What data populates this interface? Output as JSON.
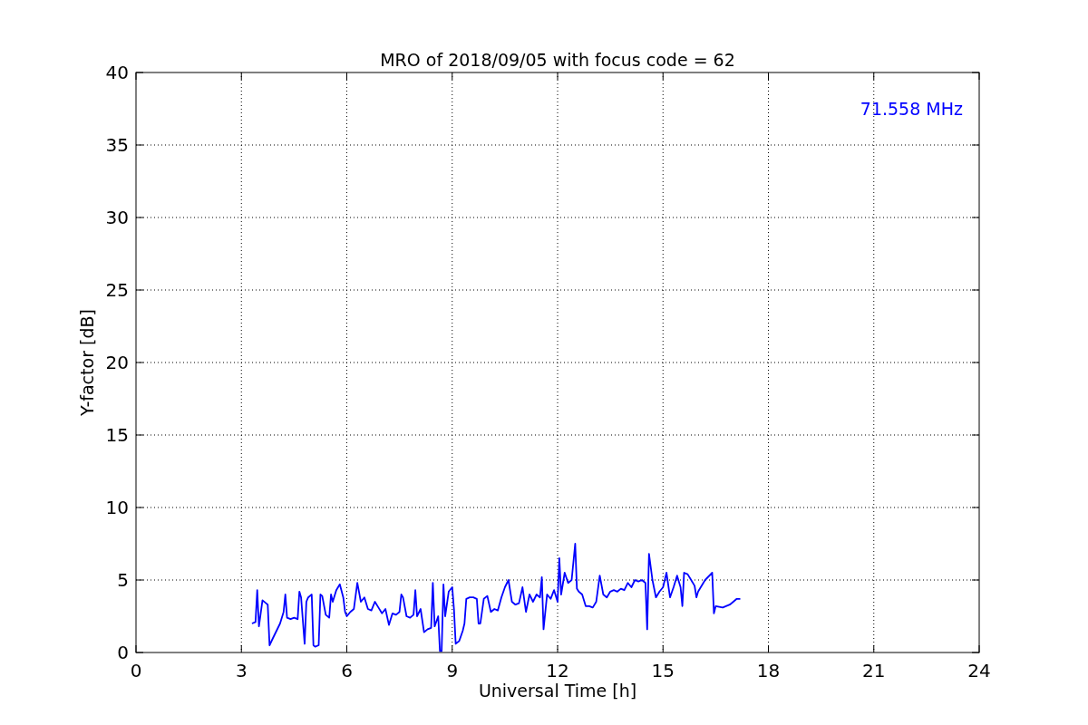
{
  "figure": {
    "chart_data": {
      "type": "line",
      "title": "MRO of 2018/09/05 with focus code = 62",
      "xlabel": "Universal Time [h]",
      "ylabel": "Y-factor [dB]",
      "x": [
        3.3,
        3.4,
        3.45,
        3.5,
        3.6,
        3.7,
        3.75,
        3.8,
        3.9,
        4.0,
        4.1,
        4.2,
        4.25,
        4.3,
        4.4,
        4.5,
        4.6,
        4.65,
        4.7,
        4.8,
        4.85,
        4.9,
        5.0,
        5.05,
        5.1,
        5.2,
        5.25,
        5.3,
        5.4,
        5.5,
        5.55,
        5.6,
        5.7,
        5.8,
        5.9,
        5.95,
        6.0,
        6.1,
        6.2,
        6.3,
        6.4,
        6.5,
        6.6,
        6.7,
        6.8,
        6.9,
        7.0,
        7.1,
        7.2,
        7.3,
        7.4,
        7.5,
        7.55,
        7.6,
        7.7,
        7.8,
        7.9,
        7.95,
        8.0,
        8.1,
        8.2,
        8.3,
        8.4,
        8.45,
        8.5,
        8.6,
        8.65,
        8.7,
        8.75,
        8.8,
        8.9,
        9.0,
        9.05,
        9.1,
        9.2,
        9.3,
        9.35,
        9.4,
        9.5,
        9.6,
        9.7,
        9.75,
        9.8,
        9.9,
        10.0,
        10.1,
        10.2,
        10.3,
        10.4,
        10.5,
        10.6,
        10.7,
        10.8,
        10.9,
        11.0,
        11.1,
        11.2,
        11.3,
        11.4,
        11.5,
        11.55,
        11.6,
        11.7,
        11.8,
        11.9,
        12.0,
        12.05,
        12.1,
        12.2,
        12.3,
        12.4,
        12.5,
        12.55,
        12.6,
        12.7,
        12.8,
        12.9,
        13.0,
        13.1,
        13.2,
        13.3,
        13.4,
        13.5,
        13.6,
        13.7,
        13.8,
        13.9,
        14.0,
        14.1,
        14.2,
        14.3,
        14.4,
        14.5,
        14.55,
        14.6,
        14.7,
        14.8,
        14.9,
        15.0,
        15.1,
        15.2,
        15.3,
        15.4,
        15.5,
        15.55,
        15.6,
        15.7,
        15.8,
        15.9,
        15.95,
        16.0,
        16.2,
        16.4,
        16.45,
        16.5,
        16.7,
        16.9,
        17.0,
        17.1,
        17.2
      ],
      "series": [
        {
          "color": "#0000ff",
          "values": [
            2.0,
            2.1,
            4.3,
            1.8,
            3.6,
            3.4,
            3.3,
            0.5,
            1.0,
            1.5,
            2.0,
            2.8,
            4.0,
            2.4,
            2.3,
            2.4,
            2.3,
            4.2,
            3.8,
            0.6,
            3.5,
            3.8,
            4.0,
            0.5,
            0.4,
            0.5,
            4.0,
            3.9,
            2.6,
            2.4,
            4.0,
            3.5,
            4.3,
            4.7,
            3.8,
            2.8,
            2.5,
            2.8,
            3.0,
            4.8,
            3.5,
            3.8,
            3.0,
            2.9,
            3.5,
            3.1,
            2.7,
            3.0,
            1.9,
            2.7,
            2.6,
            2.8,
            4.0,
            3.8,
            2.5,
            2.4,
            2.6,
            4.3,
            2.5,
            3.0,
            1.4,
            1.6,
            1.7,
            4.8,
            1.8,
            2.5,
            0.1,
            0.1,
            4.7,
            2.5,
            4.2,
            4.5,
            3.0,
            0.6,
            0.8,
            1.5,
            2.0,
            3.7,
            3.8,
            3.8,
            3.7,
            2.0,
            2.0,
            3.7,
            3.9,
            2.8,
            3.0,
            2.9,
            3.8,
            4.5,
            5.0,
            3.5,
            3.3,
            3.4,
            4.5,
            2.8,
            4.0,
            3.5,
            4.0,
            3.8,
            5.2,
            1.6,
            4.0,
            3.7,
            4.3,
            3.5,
            6.5,
            4.0,
            5.5,
            4.8,
            5.0,
            7.5,
            4.4,
            4.2,
            4.0,
            3.2,
            3.2,
            3.1,
            3.5,
            5.3,
            4.0,
            3.8,
            4.2,
            4.3,
            4.2,
            4.4,
            4.3,
            4.8,
            4.5,
            5.0,
            4.9,
            5.0,
            4.8,
            1.6,
            6.8,
            5.0,
            3.8,
            4.2,
            4.5,
            5.5,
            3.8,
            4.5,
            5.3,
            4.5,
            3.2,
            5.5,
            5.4,
            5.0,
            4.6,
            3.8,
            4.2,
            5.0,
            5.5,
            2.7,
            3.2,
            3.1,
            3.3,
            3.5,
            3.7,
            3.7
          ]
        }
      ],
      "xlim": [
        0,
        24
      ],
      "ylim": [
        0,
        40
      ],
      "xticks": [
        0,
        3,
        6,
        9,
        12,
        15,
        18,
        21,
        24
      ],
      "yticks": [
        0,
        5,
        10,
        15,
        20,
        25,
        30,
        35,
        40
      ],
      "grid": true,
      "annotations": [
        "71.558 MHz"
      ]
    }
  }
}
